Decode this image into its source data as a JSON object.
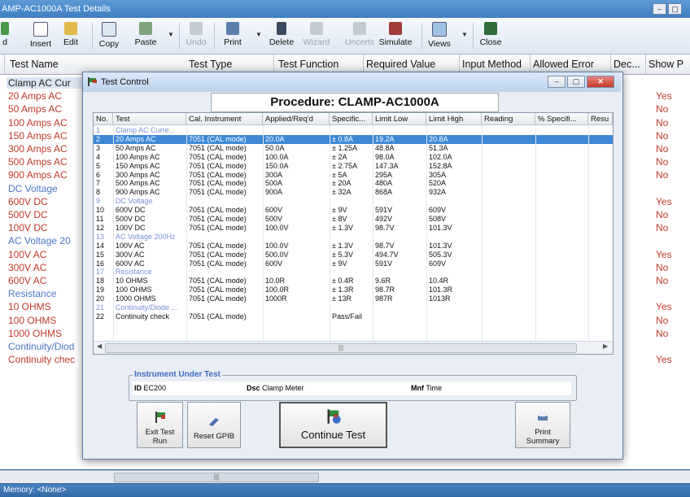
{
  "window": {
    "title": "AMP-AC1000A Test Details"
  },
  "toolbar": {
    "buttons": [
      {
        "label": "d"
      },
      {
        "label": "Insert"
      },
      {
        "label": "Edit"
      },
      {
        "label": "Copy"
      },
      {
        "label": "Paste"
      },
      {
        "label": "Undo"
      },
      {
        "label": "Print"
      },
      {
        "label": "Delete"
      },
      {
        "label": "Wizard"
      },
      {
        "label": "Uncerts"
      },
      {
        "label": "Simulate"
      },
      {
        "label": "Views"
      },
      {
        "label": "Close"
      }
    ]
  },
  "grid": {
    "columns": [
      "Test Name",
      "Test Type",
      "Test Function",
      "Required Value",
      "Input Method",
      "Allowed Error",
      "Dec...",
      "Show P"
    ],
    "rows": [
      {
        "name": "Clamp AC Cur",
        "kind": "first",
        "show": ""
      },
      {
        "name": "20 Amps AC",
        "kind": "test",
        "show": "Yes"
      },
      {
        "name": "50 Amps AC",
        "kind": "test",
        "show": "No"
      },
      {
        "name": "100 Amps AC",
        "kind": "test",
        "show": "No"
      },
      {
        "name": "150 Amps AC",
        "kind": "test",
        "show": "No"
      },
      {
        "name": "300 Amps AC",
        "kind": "test",
        "show": "No"
      },
      {
        "name": "500 Amps AC",
        "kind": "test",
        "show": "No"
      },
      {
        "name": "900 Amps AC",
        "kind": "test",
        "show": "No"
      },
      {
        "name": "DC Voltage",
        "kind": "sec",
        "show": ""
      },
      {
        "name": "600V DC",
        "kind": "test",
        "show": "Yes"
      },
      {
        "name": "500V DC",
        "kind": "test",
        "show": "No"
      },
      {
        "name": "100V DC",
        "kind": "test",
        "show": "No"
      },
      {
        "name": "AC Voltage 20",
        "kind": "sec",
        "show": ""
      },
      {
        "name": "100V AC",
        "kind": "test",
        "show": "Yes"
      },
      {
        "name": "300V AC",
        "kind": "test",
        "show": "No"
      },
      {
        "name": "600V AC",
        "kind": "test",
        "show": "No"
      },
      {
        "name": "Resistance",
        "kind": "sec",
        "show": ""
      },
      {
        "name": "10 OHMS",
        "kind": "test",
        "show": "Yes"
      },
      {
        "name": "100 OHMS",
        "kind": "test",
        "show": "No"
      },
      {
        "name": "1000 OHMS",
        "kind": "test",
        "show": "No"
      },
      {
        "name": "Continuity/Diod",
        "kind": "sec",
        "show": ""
      },
      {
        "name": "Continuity chec",
        "kind": "test",
        "show": "Yes"
      }
    ]
  },
  "status": {
    "memory": "Memory: <None>"
  },
  "dialog": {
    "title": "Test Control",
    "procedure": "Procedure: CLAMP-AC1000A",
    "columns": [
      "No.",
      "Test",
      "Cal. Instrument",
      "Applied/Req'd",
      "Specific...",
      "Limit Low",
      "Limit High",
      "Reading",
      "% Specifi...",
      "Resu"
    ],
    "rows": [
      [
        "1",
        "Clamp AC Curre...",
        "",
        "",
        "",
        "",
        "",
        "",
        "",
        ""
      ],
      [
        "2",
        "20 Amps AC",
        "7051 (CAL mode)",
        "20.0A",
        "± 0.8A",
        "19.2A",
        "20.8A",
        "",
        "",
        ""
      ],
      [
        "3",
        "50 Amps AC",
        "7051 (CAL mode)",
        "50.0A",
        "± 1.25A",
        "48.8A",
        "51.3A",
        "",
        "",
        ""
      ],
      [
        "4",
        "100 Amps AC",
        "7051 (CAL mode)",
        "100.0A",
        "± 2A",
        "98.0A",
        "102.0A",
        "",
        "",
        ""
      ],
      [
        "5",
        "150 Amps AC",
        "7051 (CAL mode)",
        "150.0A",
        "± 2.75A",
        "147.3A",
        "152.8A",
        "",
        "",
        ""
      ],
      [
        "6",
        "300 Amps AC",
        "7051 (CAL mode)",
        "300A",
        "± 5A",
        "295A",
        "305A",
        "",
        "",
        ""
      ],
      [
        "7",
        "500 Amps AC",
        "7051 (CAL mode)",
        "500A",
        "± 20A",
        "480A",
        "520A",
        "",
        "",
        ""
      ],
      [
        "8",
        "900 Amps AC",
        "7051 (CAL mode)",
        "900A",
        "± 32A",
        "868A",
        "932A",
        "",
        "",
        ""
      ],
      [
        "9",
        "DC Voltage",
        "",
        "",
        "",
        "",
        "",
        "",
        "",
        ""
      ],
      [
        "10",
        "600V DC",
        "7051 (CAL mode)",
        "600V",
        "± 9V",
        "591V",
        "609V",
        "",
        "",
        ""
      ],
      [
        "11",
        "500V DC",
        "7051 (CAL mode)",
        "500V",
        "± 8V",
        "492V",
        "508V",
        "",
        "",
        ""
      ],
      [
        "12",
        "100V DC",
        "7051 (CAL mode)",
        "100.0V",
        "± 1.3V",
        "98.7V",
        "101.3V",
        "",
        "",
        ""
      ],
      [
        "13",
        "AC Voltage 200Hz",
        "",
        "",
        "",
        "",
        "",
        "",
        "",
        ""
      ],
      [
        "14",
        "100V AC",
        "7051 (CAL mode)",
        "100.0V",
        "± 1.3V",
        "98.7V",
        "101.3V",
        "",
        "",
        ""
      ],
      [
        "15",
        "300V AC",
        "7051 (CAL mode)",
        "500.0V",
        "± 5.3V",
        "494.7V",
        "505.3V",
        "",
        "",
        ""
      ],
      [
        "16",
        "600V AC",
        "7051 (CAL mode)",
        "600V",
        "± 9V",
        "591V",
        "609V",
        "",
        "",
        ""
      ],
      [
        "17",
        "Resistance",
        "",
        "",
        "",
        "",
        "",
        "",
        "",
        ""
      ],
      [
        "18",
        "10 OHMS",
        "7051 (CAL mode)",
        "10.0R",
        "± 0.4R",
        "9.6R",
        "10.4R",
        "",
        "",
        ""
      ],
      [
        "19",
        "100 OHMS",
        "7051 (CAL mode)",
        "100.0R",
        "± 1.3R",
        "98.7R",
        "101.3R",
        "",
        "",
        ""
      ],
      [
        "20",
        "1000 OHMS",
        "7051 (CAL mode)",
        "1000R",
        "± 13R",
        "987R",
        "1013R",
        "",
        "",
        ""
      ],
      [
        "21",
        "Continuity/Diode ...",
        "",
        "",
        "",
        "",
        "",
        "",
        "",
        ""
      ],
      [
        "22",
        "Continuity check",
        "7051 (CAL mode)",
        "",
        "Pass/Fail",
        "",
        "",
        "",
        "",
        ""
      ]
    ],
    "section_rows": [
      0,
      8,
      12,
      16,
      20
    ],
    "selected_row": 1,
    "instrument": {
      "legend": "Instrument Under Test",
      "id_label": "ID",
      "id_value": "EC200",
      "dsc_label": "Dsc",
      "dsc_value": "Clamp Meter",
      "mnf_label": "Mnf",
      "mnf_value": "Time"
    },
    "buttons": {
      "exit": "Exit Test Run",
      "reset": "Reset GPIB",
      "continue": "Continue Test",
      "print": "Print Summary"
    }
  },
  "colors": {
    "test_text": "#c0392b",
    "section_text": "#4b76c6",
    "selection": "#3e88d6"
  }
}
